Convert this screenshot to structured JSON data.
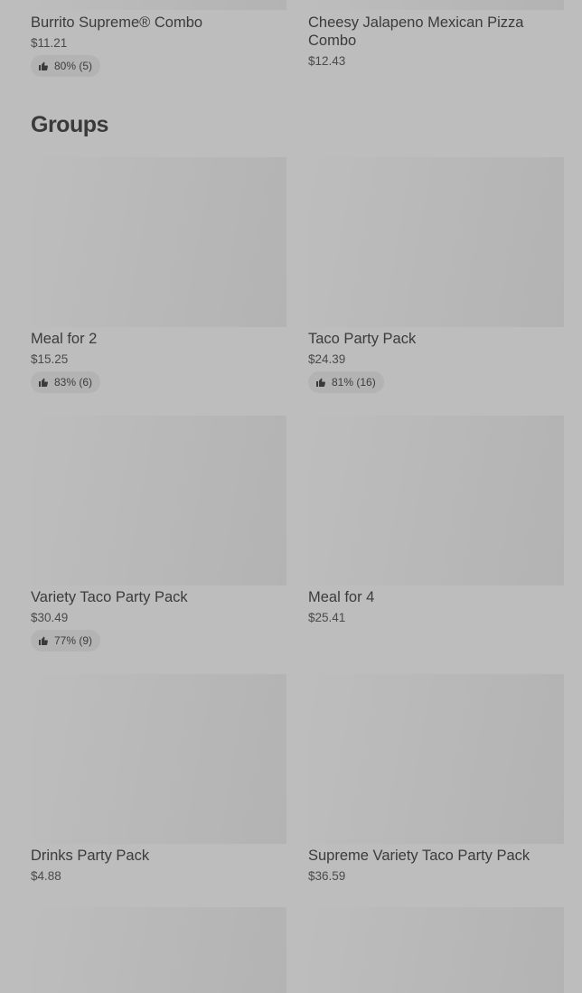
{
  "top_items": [
    {
      "name": "Burrito Supreme® Combo",
      "price": "$11.21",
      "rating": "80% (5)"
    },
    {
      "name": "Cheesy Jalapeno Mexican Pizza Combo",
      "price": "$12.43"
    }
  ],
  "groups": {
    "title": "Groups",
    "items": [
      {
        "name": "Meal for 2",
        "price": "$15.25",
        "rating": "83% (6)"
      },
      {
        "name": "Taco Party Pack",
        "price": "$24.39",
        "rating": "81% (16)"
      },
      {
        "name": "Variety Taco Party Pack",
        "price": "$30.49",
        "rating": "77% (9)"
      },
      {
        "name": "Meal for 4",
        "price": "$25.41"
      },
      {
        "name": "Drinks Party Pack",
        "price": "$4.88"
      },
      {
        "name": "Supreme Variety Taco Party Pack",
        "price": "$36.59"
      }
    ]
  },
  "icons": {
    "rating": "thumbs-up-icon"
  }
}
